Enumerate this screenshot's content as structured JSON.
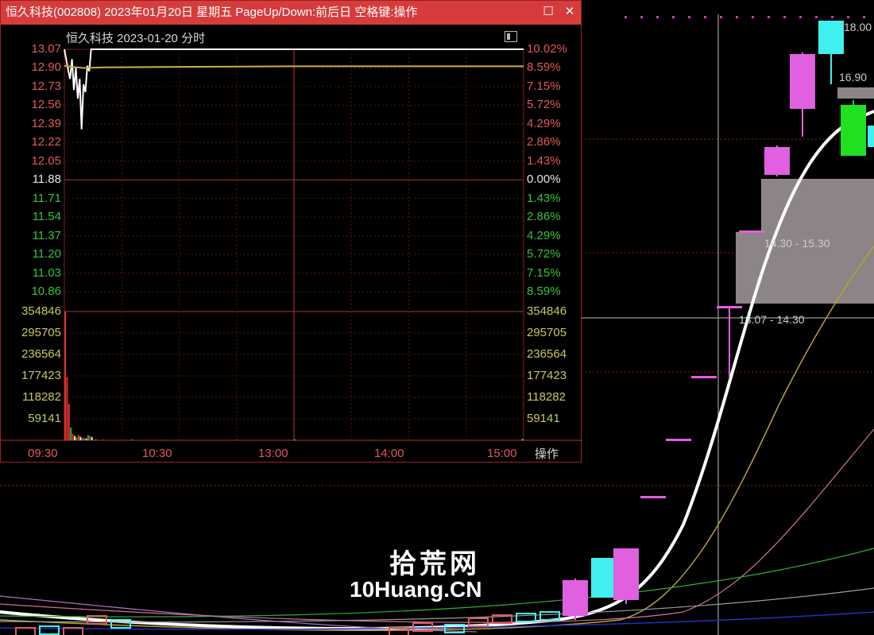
{
  "window": {
    "title": "恒久科技(002808) 2023年01月20日 星期五 PageUp/Down:前后日 空格键:操作",
    "subtitle": "恒久科技 2023-01-20 分时"
  },
  "intraday": {
    "price_labels": [
      {
        "price": "13.07",
        "pct": "10.02%",
        "color": "red"
      },
      {
        "price": "12.90",
        "pct": "8.59%",
        "color": "red"
      },
      {
        "price": "12.73",
        "pct": "7.15%",
        "color": "red"
      },
      {
        "price": "12.56",
        "pct": "5.72%",
        "color": "red"
      },
      {
        "price": "12.39",
        "pct": "4.29%",
        "color": "red"
      },
      {
        "price": "12.22",
        "pct": "2.86%",
        "color": "red"
      },
      {
        "price": "12.05",
        "pct": "1.43%",
        "color": "red"
      },
      {
        "price": "11.88",
        "pct": "0.00%",
        "color": "white"
      },
      {
        "price": "11.71",
        "pct": "1.43%",
        "color": "green"
      },
      {
        "price": "11.54",
        "pct": "2.86%",
        "color": "green"
      },
      {
        "price": "11.37",
        "pct": "4.29%",
        "color": "green"
      },
      {
        "price": "11.20",
        "pct": "5.72%",
        "color": "green"
      },
      {
        "price": "11.03",
        "pct": "7.15%",
        "color": "green"
      },
      {
        "price": "10.86",
        "pct": "8.59%",
        "color": "green"
      }
    ],
    "volume_labels": [
      "354846",
      "295705",
      "236564",
      "177423",
      "118282",
      "59141"
    ],
    "time_labels": [
      "09:30",
      "10:30",
      "13:00",
      "14:00",
      "15:00"
    ],
    "op_label": "操作",
    "price_line": [
      [
        0,
        13.07
      ],
      [
        2,
        12.88
      ],
      [
        3,
        12.8
      ],
      [
        4,
        12.98
      ],
      [
        5,
        12.7
      ],
      [
        6,
        12.9
      ],
      [
        7,
        12.62
      ],
      [
        8,
        12.8
      ],
      [
        9,
        12.34
      ],
      [
        10,
        12.75
      ],
      [
        11,
        12.68
      ],
      [
        12,
        12.92
      ],
      [
        13,
        12.87
      ],
      [
        14,
        13.07
      ],
      [
        240,
        13.07
      ]
    ],
    "avg_line": [
      [
        0,
        12.92
      ],
      [
        4,
        12.91
      ],
      [
        10,
        12.9
      ],
      [
        20,
        12.905
      ],
      [
        60,
        12.91
      ],
      [
        120,
        12.915
      ],
      [
        240,
        12.915
      ]
    ],
    "volumes": [
      [
        0,
        354846
      ],
      [
        1,
        175000
      ],
      [
        2,
        100000
      ],
      [
        3,
        35000
      ],
      [
        4,
        18000
      ],
      [
        5,
        12000
      ],
      [
        6,
        9000
      ],
      [
        7,
        15000
      ],
      [
        8,
        10000
      ],
      [
        9,
        6000
      ],
      [
        10,
        7000
      ],
      [
        11,
        5000
      ],
      [
        12,
        14000
      ],
      [
        13,
        12000
      ],
      [
        14,
        9000
      ],
      [
        16,
        3000
      ],
      [
        20,
        2500
      ],
      [
        35,
        1500
      ],
      [
        50,
        1200
      ],
      [
        90,
        2200
      ],
      [
        120,
        1500
      ],
      [
        160,
        1200
      ],
      [
        200,
        1000
      ],
      [
        239,
        3000
      ]
    ]
  },
  "kline": {
    "labels": {
      "high": "18.00",
      "mid": "16.90",
      "range_upper": "14.30 - 15.30",
      "range_lower": "13.07 - 14.30"
    }
  },
  "logo": {
    "line1": "拾荒网",
    "line2": "10Huang.CN"
  }
}
